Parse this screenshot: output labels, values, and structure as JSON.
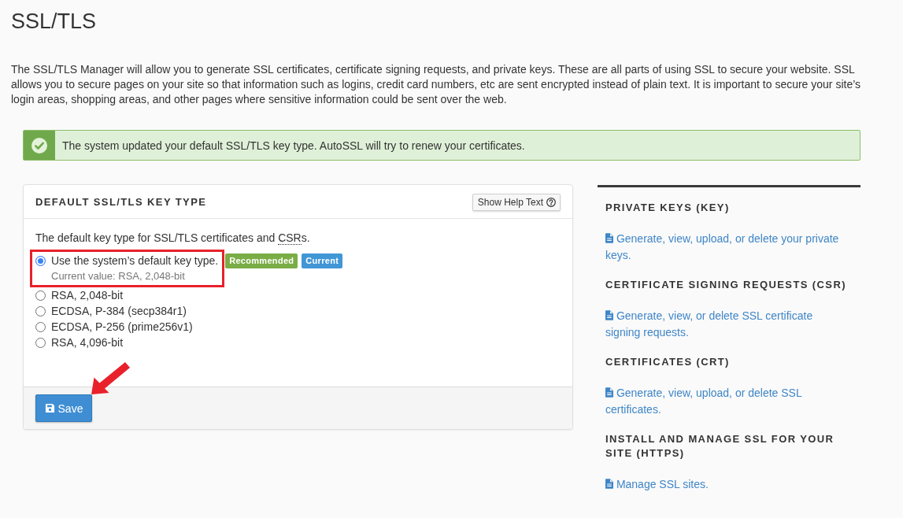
{
  "page": {
    "title": "SSL/TLS",
    "description": "The SSL/TLS Manager will allow you to generate SSL certificates, certificate signing requests, and private keys. These are all parts of using SSL to secure your website. SSL allows you to secure pages on your site so that information such as logins, credit card numbers, etc are sent encrypted instead of plain text. It is important to secure your site’s login areas, shopping areas, and other pages where sensitive information could be sent over the web."
  },
  "alert": {
    "kind": "success",
    "message": "The system updated your default SSL/TLS key type. AutoSSL will try to renew your certificates."
  },
  "key_type_panel": {
    "title": "DEFAULT SSL/TLS KEY TYPE",
    "help_button": "Show Help Text",
    "intro": {
      "text_before": "The default key type for SSL/TLS certificates and ",
      "abbreviation": "CSR",
      "text_after": "s."
    },
    "options": [
      {
        "label": "Use the system’s default key type.",
        "selected": true,
        "annotation_box": true,
        "note": "Current value: RSA, 2,048-bit",
        "badges": [
          {
            "label": "Recommended",
            "kind": "recommended"
          },
          {
            "label": "Current",
            "kind": "current"
          }
        ]
      },
      {
        "label": "RSA, 2,048-bit",
        "selected": false,
        "annotation_box": false
      },
      {
        "label": "ECDSA, P-384 (secp384r1)",
        "selected": false,
        "annotation_box": false
      },
      {
        "label": "ECDSA, P-256 (prime256v1)",
        "selected": false,
        "annotation_box": false
      },
      {
        "label": "RSA, 4,096-bit",
        "selected": false,
        "annotation_box": false
      }
    ],
    "save_button": {
      "label": "Save",
      "arrow_annotation": true
    }
  },
  "sidebar": {
    "sections": [
      {
        "heading": "PRIVATE KEYS (KEY)",
        "link": "Generate, view, upload, or delete your private keys."
      },
      {
        "heading": "CERTIFICATE SIGNING REQUESTS (CSR)",
        "link": "Generate, view, or delete SSL certificate signing requests."
      },
      {
        "heading": "CERTIFICATES (CRT)",
        "link": "Generate, view, upload, or delete SSL certificates."
      },
      {
        "heading": "INSTALL AND MANAGE SSL FOR YOUR SITE (HTTPS)",
        "link": "Manage SSL sites."
      }
    ]
  }
}
